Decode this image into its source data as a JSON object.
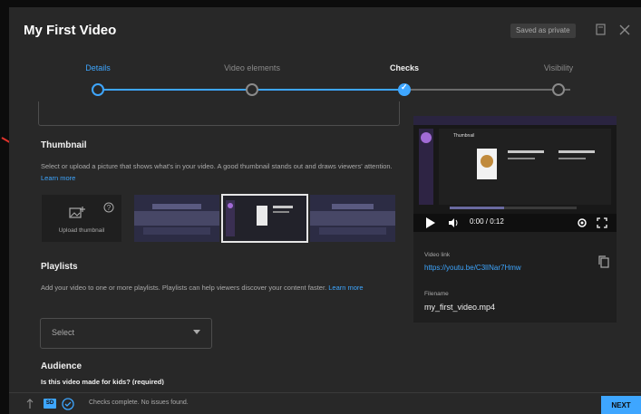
{
  "dialog": {
    "title": "My First Video",
    "saved_status": "Saved as private"
  },
  "stepper": {
    "steps": [
      {
        "label": "Details",
        "state": "active"
      },
      {
        "label": "Video elements",
        "state": "todo"
      },
      {
        "label": "Checks",
        "state": "done"
      },
      {
        "label": "Visibility",
        "state": "todo"
      }
    ]
  },
  "thumbnail": {
    "title": "Thumbnail",
    "description": "Select or upload a picture that shows what's in your video. A good thumbnail stands out and draws viewers' attention.",
    "learn_more": "Learn more",
    "upload_label": "Upload thumbnail"
  },
  "playlists": {
    "title": "Playlists",
    "description": "Add your video to one or more playlists. Playlists can help viewers discover your content faster.",
    "learn_more": "Learn more",
    "select_value": "Select"
  },
  "audience": {
    "title": "Audience",
    "question": "Is this video made for kids? (required)"
  },
  "preview": {
    "time": "0:00 / 0:12",
    "video_link_label": "Video link",
    "video_link": "https://youtu.be/C3lINar7Hmw",
    "filename_label": "Filename",
    "filename": "my_first_video.mp4",
    "mini_title": "Thumbnail"
  },
  "footer": {
    "hd_badge": "SD",
    "status": "Checks complete. No issues found.",
    "next_label": "NEXT"
  },
  "colors": {
    "accent": "#3ea6ff",
    "annotation": "#e0322b",
    "background": "#282828"
  }
}
